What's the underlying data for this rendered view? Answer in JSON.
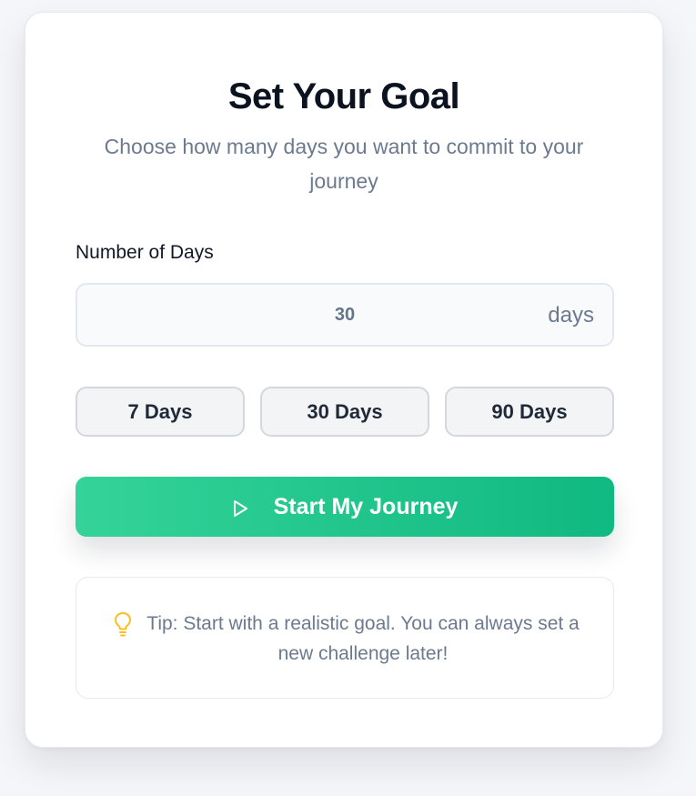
{
  "goal_card": {
    "title": "Set Your Goal",
    "subtitle": "Choose how many days you want to commit to your journey",
    "days_field": {
      "label": "Number of Days",
      "value": "30",
      "unit": "days"
    },
    "presets": [
      {
        "label": "7 Days"
      },
      {
        "label": "30 Days"
      },
      {
        "label": "90 Days"
      }
    ],
    "start_button": {
      "label": "Start My Journey",
      "icon": "play-icon"
    },
    "tip": {
      "icon": "lightbulb-icon",
      "text": "Tip: Start with a realistic goal. You can always set a new challenge later!"
    }
  },
  "colors": {
    "accent_start": "#34d399",
    "accent_end": "#10b981",
    "tip_icon": "#fbbf24",
    "muted_text": "#6b7a8f",
    "heading_text": "#0b1220"
  }
}
